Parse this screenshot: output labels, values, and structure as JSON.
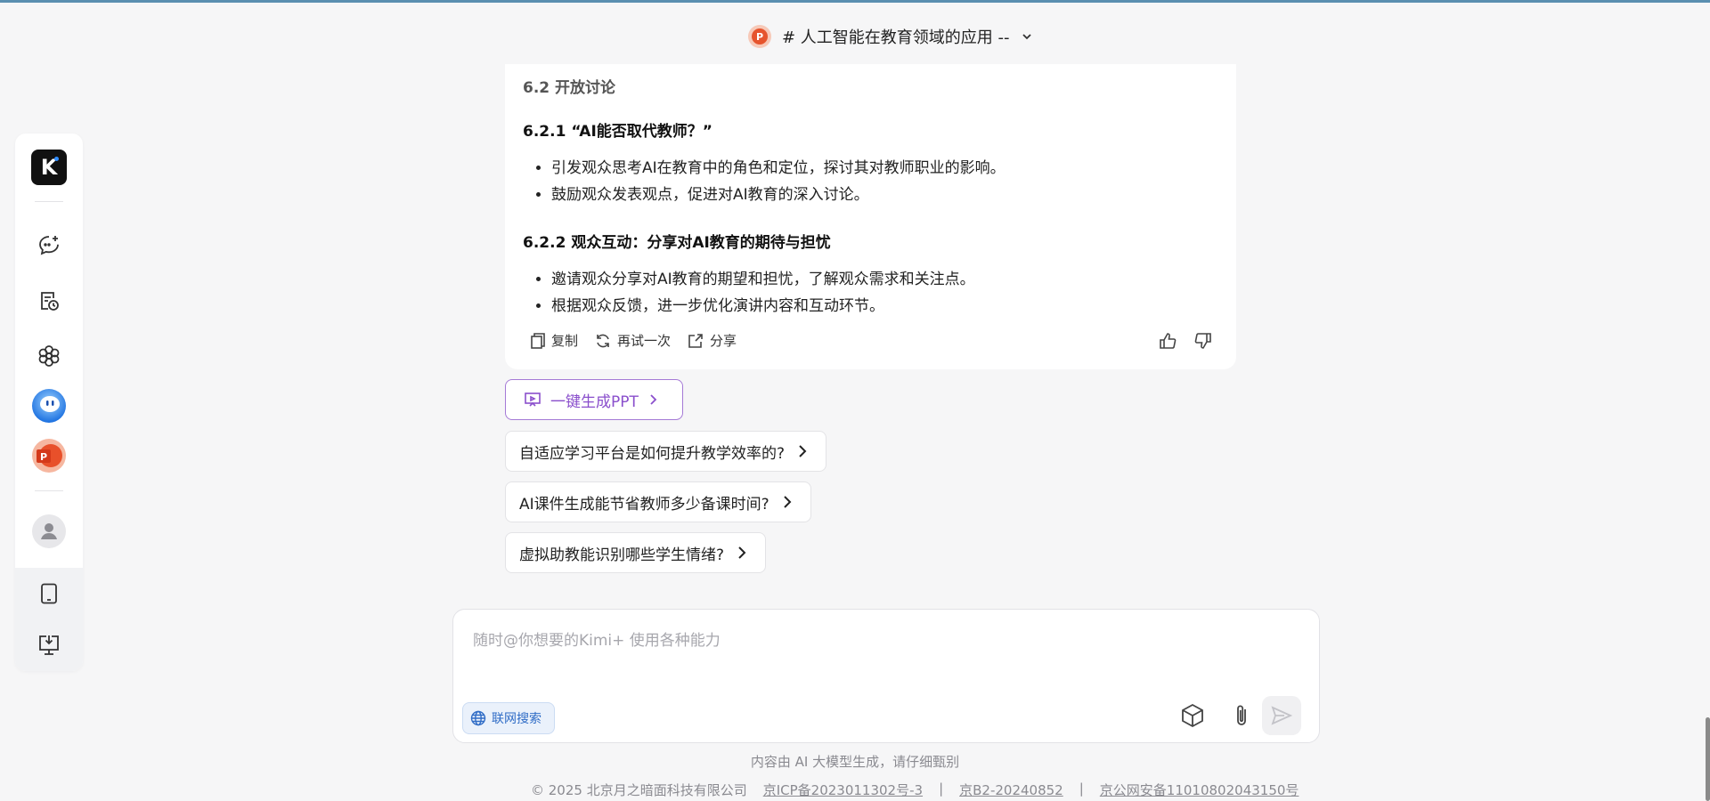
{
  "header": {
    "title": "# 人工智能在教育领域的应用 --",
    "badge_letter": "P"
  },
  "sidebar": {
    "logo_letter": "K"
  },
  "message": {
    "section_title": "6.2 开放讨论",
    "sub1_title": "6.2.1 “AI能否取代教师？”",
    "sub1_items": [
      "引发观众思考AI在教育中的角色和定位，探讨其对教师职业的影响。",
      "鼓励观众发表观点，促进对AI教育的深入讨论。"
    ],
    "sub2_title": "6.2.2 观众互动：分享对AI教育的期待与担忧",
    "sub2_items": [
      "邀请观众分享对AI教育的期望和担忧，了解观众需求和关注点。",
      "根据观众反馈，进一步优化演讲内容和互动环节。"
    ],
    "actions": {
      "copy": "复制",
      "retry": "再试一次",
      "share": "分享"
    }
  },
  "ppt_button": {
    "label": "一键生成PPT"
  },
  "suggestions": [
    "自适应学习平台是如何提升教学效率的?",
    "AI课件生成能节省教师多少备课时间?",
    "虚拟助教能识别哪些学生情绪?"
  ],
  "composer": {
    "placeholder": "随时@你想要的Kimi+ 使用各种能力",
    "web_search": "联网搜索"
  },
  "footer": {
    "disclaimer": "内容由 AI 大模型生成，请仔细甄别",
    "copyright": "© 2025 北京月之暗面科技有限公司",
    "icp": "京ICP备2023011302号-3",
    "sep1": "|",
    "b2": "京B2-20240852",
    "sep2": "|",
    "police": "京公网安备11010802043150号"
  }
}
